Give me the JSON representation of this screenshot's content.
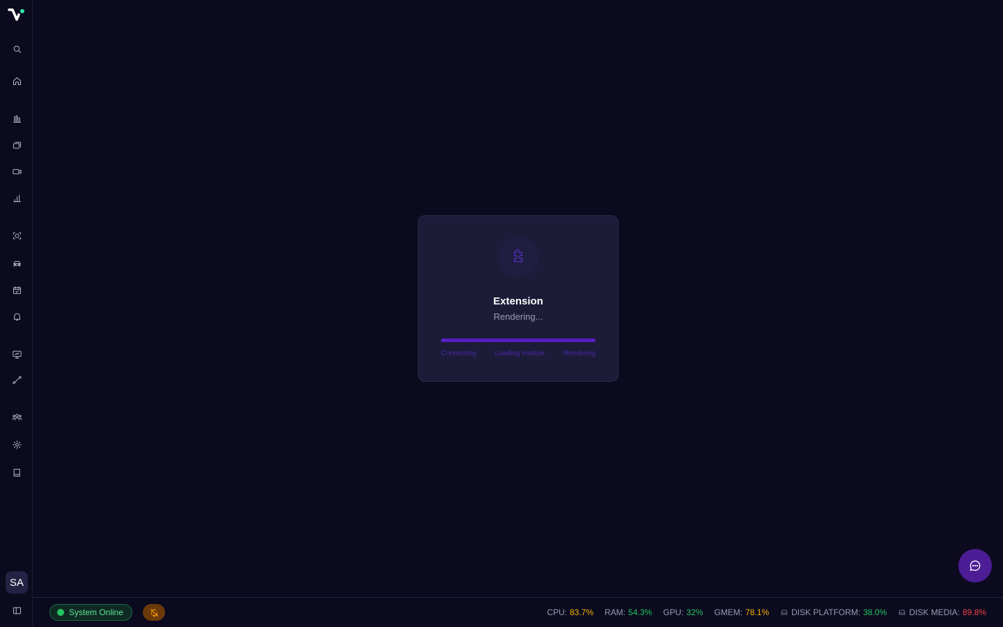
{
  "sidebar": {
    "items": [
      {
        "name": "search",
        "icon": "search-icon"
      },
      {
        "name": "home",
        "icon": "home-icon"
      },
      {
        "name": "buildings",
        "icon": "building-icon"
      },
      {
        "name": "layers",
        "icon": "layers-icon"
      },
      {
        "name": "cameras",
        "icon": "video-camera-icon"
      },
      {
        "name": "analytics",
        "icon": "bar-chart-icon"
      },
      {
        "name": "face-scan",
        "icon": "face-scan-icon"
      },
      {
        "name": "vehicles",
        "icon": "car-icon"
      },
      {
        "name": "schedule",
        "icon": "calendar-check-icon"
      },
      {
        "name": "alerts",
        "icon": "bell-icon"
      },
      {
        "name": "monitor",
        "icon": "monitor-chart-icon"
      },
      {
        "name": "routes",
        "icon": "route-icon"
      },
      {
        "name": "users",
        "icon": "users-icon"
      },
      {
        "name": "settings",
        "icon": "gear-icon"
      },
      {
        "name": "docs",
        "icon": "book-icon"
      }
    ],
    "avatar_initials": "SA"
  },
  "loader": {
    "icon": "puzzle-icon",
    "title": "Extension",
    "subtitle": "Rendering...",
    "progress": 1.0,
    "steps": [
      "Connecting",
      "Loading module",
      "Rendering"
    ]
  },
  "statusbar": {
    "online_label": "System Online",
    "metrics": [
      {
        "label": "CPU:",
        "value": "83.7%",
        "color": "#f5b400"
      },
      {
        "label": "RAM:",
        "value": "54.3%",
        "color": "#22c55e"
      },
      {
        "label": "GPU:",
        "value": "32%",
        "color": "#22c55e"
      },
      {
        "label": "GMEM:",
        "value": "78.1%",
        "color": "#f5b400"
      },
      {
        "label": "DISK PLATFORM:",
        "value": "38.0%",
        "color": "#22c55e",
        "icon": "hard-drive-icon"
      },
      {
        "label": "DISK MEDIA:",
        "value": "89.8%",
        "color": "#ef4444",
        "icon": "hard-drive-icon"
      }
    ]
  },
  "colors": {
    "background": "#0c0a1f",
    "accent": "#5a1fc4",
    "online": "#22c55e",
    "warning": "#f59e0b"
  }
}
